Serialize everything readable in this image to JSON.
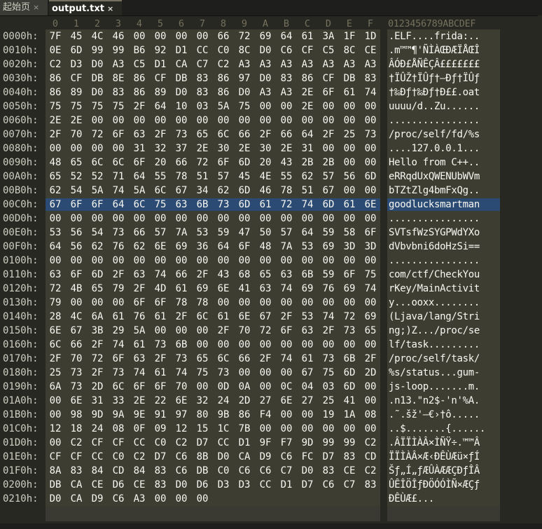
{
  "tabs": [
    {
      "label": "起始页",
      "close": "×"
    },
    {
      "label": "output.txt",
      "close": "×"
    }
  ],
  "col_headers": [
    "0",
    "1",
    "2",
    "3",
    "4",
    "5",
    "6",
    "7",
    "8",
    "9",
    "A",
    "B",
    "C",
    "D",
    "E",
    "F"
  ],
  "ascii_header": "0123456789ABCDEF",
  "rows": [
    {
      "addr": "0000h:",
      "bytes": [
        "7F",
        "45",
        "4C",
        "46",
        "00",
        "00",
        "00",
        "00",
        "66",
        "72",
        "69",
        "64",
        "61",
        "3A",
        "1F",
        "1D"
      ],
      "ascii": ".ELF....frida:.."
    },
    {
      "addr": "0010h:",
      "bytes": [
        "0E",
        "6D",
        "99",
        "99",
        "B6",
        "92",
        "D1",
        "CC",
        "C0",
        "8C",
        "D0",
        "C6",
        "CF",
        "C5",
        "8C",
        "CE"
      ],
      "ascii": ".m™™¶'ÑÌÀŒÐÆÏÅŒÎ"
    },
    {
      "addr": "0020h:",
      "bytes": [
        "C2",
        "D3",
        "D0",
        "A3",
        "C5",
        "D1",
        "CA",
        "C7",
        "C2",
        "A3",
        "A3",
        "A3",
        "A3",
        "A3",
        "A3",
        "A3"
      ],
      "ascii": "ÂÓÐ£ÅÑÊÇÂ£££££££"
    },
    {
      "addr": "0030h:",
      "bytes": [
        "86",
        "CF",
        "DB",
        "8E",
        "86",
        "CF",
        "DB",
        "83",
        "86",
        "97",
        "D0",
        "83",
        "86",
        "CF",
        "DB",
        "83"
      ],
      "ascii": "†ÏÛŽ†ÏÛƒ†—Ðƒ†ÏÛƒ"
    },
    {
      "addr": "0040h:",
      "bytes": [
        "86",
        "89",
        "D0",
        "83",
        "86",
        "89",
        "D0",
        "83",
        "86",
        "D0",
        "A3",
        "A3",
        "2E",
        "6F",
        "61",
        "74"
      ],
      "ascii": "†‰Ðƒ†‰Ðƒ†Ð££.oat"
    },
    {
      "addr": "0050h:",
      "bytes": [
        "75",
        "75",
        "75",
        "75",
        "2F",
        "64",
        "10",
        "03",
        "5A",
        "75",
        "00",
        "00",
        "2E",
        "00",
        "00",
        "00"
      ],
      "ascii": "uuuu/d..Zu......"
    },
    {
      "addr": "0060h:",
      "bytes": [
        "2E",
        "2E",
        "00",
        "00",
        "00",
        "00",
        "00",
        "00",
        "00",
        "00",
        "00",
        "00",
        "00",
        "00",
        "00",
        "00"
      ],
      "ascii": "................"
    },
    {
      "addr": "0070h:",
      "bytes": [
        "2F",
        "70",
        "72",
        "6F",
        "63",
        "2F",
        "73",
        "65",
        "6C",
        "66",
        "2F",
        "66",
        "64",
        "2F",
        "25",
        "73"
      ],
      "ascii": "/proc/self/fd/%s"
    },
    {
      "addr": "0080h:",
      "bytes": [
        "00",
        "00",
        "00",
        "00",
        "31",
        "32",
        "37",
        "2E",
        "30",
        "2E",
        "30",
        "2E",
        "31",
        "00",
        "00",
        "00"
      ],
      "ascii": "....127.0.0.1..."
    },
    {
      "addr": "0090h:",
      "bytes": [
        "48",
        "65",
        "6C",
        "6C",
        "6F",
        "20",
        "66",
        "72",
        "6F",
        "6D",
        "20",
        "43",
        "2B",
        "2B",
        "00",
        "00"
      ],
      "ascii": "Hello from C++.."
    },
    {
      "addr": "00A0h:",
      "bytes": [
        "65",
        "52",
        "52",
        "71",
        "64",
        "55",
        "78",
        "51",
        "57",
        "45",
        "4E",
        "55",
        "62",
        "57",
        "56",
        "6D"
      ],
      "ascii": "eRRqdUxQWENUbWVm"
    },
    {
      "addr": "00B0h:",
      "bytes": [
        "62",
        "54",
        "5A",
        "74",
        "5A",
        "6C",
        "67",
        "34",
        "62",
        "6D",
        "46",
        "78",
        "51",
        "67",
        "00",
        "00"
      ],
      "ascii": "bTZtZlg4bmFxQg.."
    },
    {
      "addr": "00C0h:",
      "bytes": [
        "67",
        "6F",
        "6F",
        "64",
        "6C",
        "75",
        "63",
        "6B",
        "73",
        "6D",
        "61",
        "72",
        "74",
        "6D",
        "61",
        "6E"
      ],
      "ascii": "goodlucksmartman"
    },
    {
      "addr": "00D0h:",
      "bytes": [
        "00",
        "00",
        "00",
        "00",
        "00",
        "00",
        "00",
        "00",
        "00",
        "00",
        "00",
        "00",
        "00",
        "00",
        "00",
        "00"
      ],
      "ascii": "................"
    },
    {
      "addr": "00E0h:",
      "bytes": [
        "53",
        "56",
        "54",
        "73",
        "66",
        "57",
        "7A",
        "53",
        "59",
        "47",
        "50",
        "57",
        "64",
        "59",
        "58",
        "6F"
      ],
      "ascii": "SVTsfWzSYGPWdYXo"
    },
    {
      "addr": "00F0h:",
      "bytes": [
        "64",
        "56",
        "62",
        "76",
        "62",
        "6E",
        "69",
        "36",
        "64",
        "6F",
        "48",
        "7A",
        "53",
        "69",
        "3D",
        "3D"
      ],
      "ascii": "dVbvbni6doHzSi=="
    },
    {
      "addr": "0100h:",
      "bytes": [
        "00",
        "00",
        "00",
        "00",
        "00",
        "00",
        "00",
        "00",
        "00",
        "00",
        "00",
        "00",
        "00",
        "00",
        "00",
        "00"
      ],
      "ascii": "................"
    },
    {
      "addr": "0110h:",
      "bytes": [
        "63",
        "6F",
        "6D",
        "2F",
        "63",
        "74",
        "66",
        "2F",
        "43",
        "68",
        "65",
        "63",
        "6B",
        "59",
        "6F",
        "75"
      ],
      "ascii": "com/ctf/CheckYou"
    },
    {
      "addr": "0120h:",
      "bytes": [
        "72",
        "4B",
        "65",
        "79",
        "2F",
        "4D",
        "61",
        "69",
        "6E",
        "41",
        "63",
        "74",
        "69",
        "76",
        "69",
        "74"
      ],
      "ascii": "rKey/MainActivit"
    },
    {
      "addr": "0130h:",
      "bytes": [
        "79",
        "00",
        "00",
        "00",
        "6F",
        "6F",
        "78",
        "78",
        "00",
        "00",
        "00",
        "00",
        "00",
        "00",
        "00",
        "00"
      ],
      "ascii": "y...ooxx........"
    },
    {
      "addr": "0140h:",
      "bytes": [
        "28",
        "4C",
        "6A",
        "61",
        "76",
        "61",
        "2F",
        "6C",
        "61",
        "6E",
        "67",
        "2F",
        "53",
        "74",
        "72",
        "69"
      ],
      "ascii": "(Ljava/lang/Stri"
    },
    {
      "addr": "0150h:",
      "bytes": [
        "6E",
        "67",
        "3B",
        "29",
        "5A",
        "00",
        "00",
        "00",
        "2F",
        "70",
        "72",
        "6F",
        "63",
        "2F",
        "73",
        "65"
      ],
      "ascii": "ng;)Z.../proc/se"
    },
    {
      "addr": "0160h:",
      "bytes": [
        "6C",
        "66",
        "2F",
        "74",
        "61",
        "73",
        "6B",
        "00",
        "00",
        "00",
        "00",
        "00",
        "00",
        "00",
        "00",
        "00"
      ],
      "ascii": "lf/task........."
    },
    {
      "addr": "0170h:",
      "bytes": [
        "2F",
        "70",
        "72",
        "6F",
        "63",
        "2F",
        "73",
        "65",
        "6C",
        "66",
        "2F",
        "74",
        "61",
        "73",
        "6B",
        "2F"
      ],
      "ascii": "/proc/self/task/"
    },
    {
      "addr": "0180h:",
      "bytes": [
        "25",
        "73",
        "2F",
        "73",
        "74",
        "61",
        "74",
        "75",
        "73",
        "00",
        "00",
        "00",
        "67",
        "75",
        "6D",
        "2D"
      ],
      "ascii": "%s/status...gum-"
    },
    {
      "addr": "0190h:",
      "bytes": [
        "6A",
        "73",
        "2D",
        "6C",
        "6F",
        "6F",
        "70",
        "00",
        "0D",
        "0A",
        "00",
        "0C",
        "04",
        "03",
        "6D",
        "00"
      ],
      "ascii": "js-loop.......m."
    },
    {
      "addr": "01A0h:",
      "bytes": [
        "00",
        "6E",
        "31",
        "33",
        "2E",
        "22",
        "6E",
        "32",
        "24",
        "2D",
        "27",
        "6E",
        "27",
        "25",
        "41",
        "00"
      ],
      "ascii": ".n13.\"n2$-'n'%A."
    },
    {
      "addr": "01B0h:",
      "bytes": [
        "00",
        "98",
        "9D",
        "9A",
        "9E",
        "91",
        "97",
        "80",
        "9B",
        "86",
        "F4",
        "00",
        "00",
        "19",
        "1A",
        "08"
      ],
      "ascii": ".˜.šž'—€›†ô....."
    },
    {
      "addr": "01C0h:",
      "bytes": [
        "12",
        "18",
        "24",
        "08",
        "0F",
        "09",
        "12",
        "15",
        "1C",
        "7B",
        "00",
        "00",
        "00",
        "00",
        "00",
        "00"
      ],
      "ascii": "..$.......{......"
    },
    {
      "addr": "01D0h:",
      "bytes": [
        "00",
        "C2",
        "CF",
        "CF",
        "CC",
        "C0",
        "C2",
        "D7",
        "CC",
        "D1",
        "9F",
        "F7",
        "9D",
        "99",
        "99",
        "C2"
      ],
      "ascii": ".ÂÏÏÌÀÂ×ÌÑŸ÷.™™Â"
    },
    {
      "addr": "01E0h:",
      "bytes": [
        "CF",
        "CF",
        "CC",
        "C0",
        "C2",
        "D7",
        "C6",
        "8B",
        "D0",
        "CA",
        "D9",
        "C6",
        "FC",
        "D7",
        "83",
        "CD"
      ],
      "ascii": "ÏÏÌÀÂ×Æ‹ÐÊÙÆü×ƒÍ"
    },
    {
      "addr": "01F0h:",
      "bytes": [
        "8A",
        "83",
        "84",
        "CD",
        "84",
        "83",
        "C6",
        "DB",
        "C0",
        "C6",
        "C6",
        "C7",
        "D0",
        "83",
        "CE",
        "C2"
      ],
      "ascii": "Šƒ„Í„ƒÆÛÀÆÆÇÐƒÎÂ"
    },
    {
      "addr": "0200h:",
      "bytes": [
        "DB",
        "CA",
        "CE",
        "D6",
        "CE",
        "83",
        "D0",
        "D6",
        "D3",
        "D3",
        "CC",
        "D1",
        "D7",
        "C6",
        "C7",
        "83"
      ],
      "ascii": "ÛÊÎÖÎƒÐÖÓÓÌÑ×ÆÇƒ"
    },
    {
      "addr": "0210h:",
      "bytes": [
        "D0",
        "CA",
        "D9",
        "C6",
        "A3",
        "00",
        "00",
        "00"
      ],
      "ascii": "ÐÊÙÆ£..."
    }
  ],
  "selected_row": "00C0h:"
}
